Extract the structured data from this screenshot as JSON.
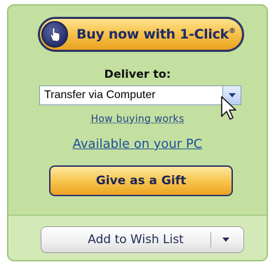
{
  "buy_button": {
    "label": "Buy now with 1-Click",
    "trademark": "®"
  },
  "deliver": {
    "label": "Deliver to:",
    "selected_value": "Transfer via Computer"
  },
  "links": {
    "how_buying_works": "How buying works",
    "available_on_pc": "Available on your PC"
  },
  "gift_button": {
    "label": "Give as a Gift"
  },
  "wish_list_button": {
    "label": "Add to Wish List"
  },
  "icons": {
    "buy": "hand-pointer-icon",
    "dropdown": "chevron-down-icon",
    "cursor": "mouse-cursor-icon"
  },
  "colors": {
    "panel_background": "#c9e3a9",
    "button_gold": "#f7c44e",
    "button_border_navy": "#2d3566",
    "link_blue": "#1a4f9c"
  }
}
